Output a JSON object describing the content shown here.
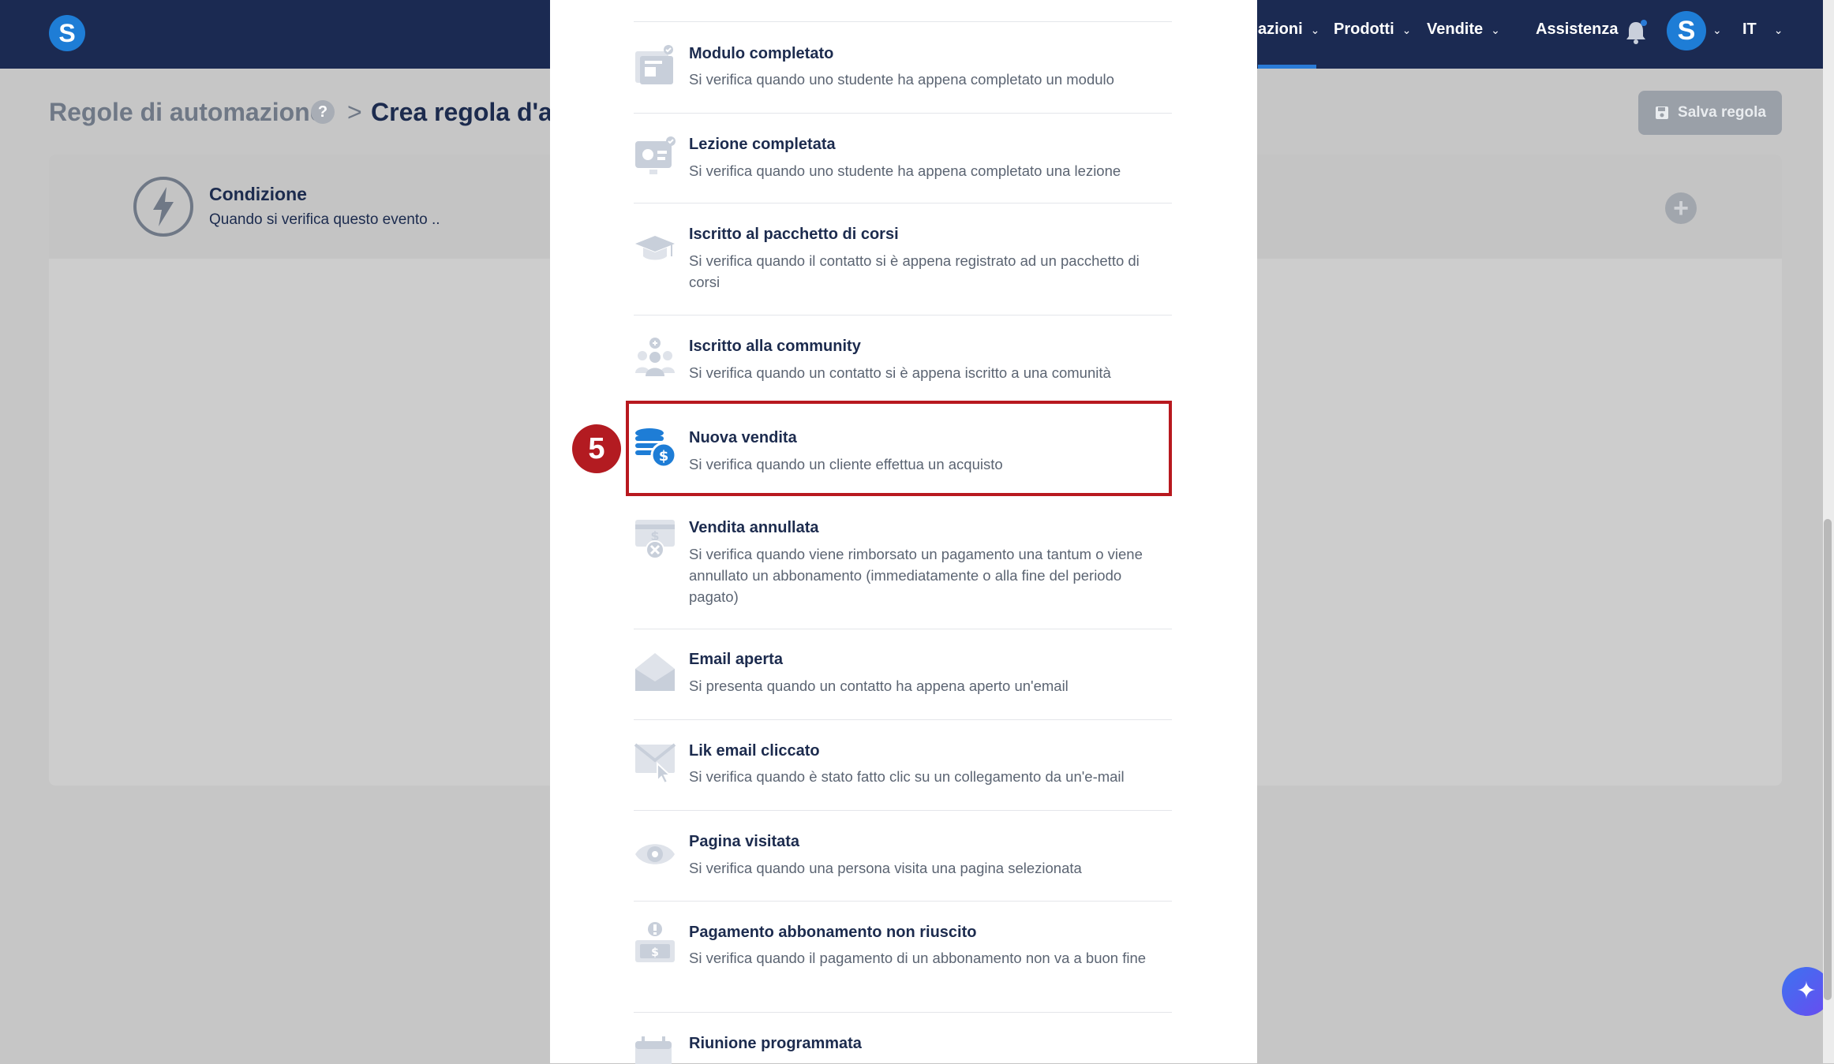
{
  "topbar": {
    "logo": "S",
    "nav": [
      {
        "label": "azioni"
      },
      {
        "label": "Prodotti"
      },
      {
        "label": "Vendite"
      },
      {
        "label": "Assistenza"
      }
    ],
    "avatar": "S",
    "language": "IT"
  },
  "page": {
    "breadcrumb_parent": "Regole di automazione",
    "help": "?",
    "breadcrumb_sep": ">",
    "breadcrumb_current": "Crea regola d'au",
    "save_label": "Salva regola"
  },
  "condition": {
    "title": "Condizione",
    "subtitle": "Quando si verifica questo evento .."
  },
  "triggers": [
    {
      "title": "Modulo completato",
      "description": "Si verifica quando uno studente ha appena completato un modulo",
      "icon": "module-complete-icon"
    },
    {
      "title": "Lezione completata",
      "description": "Si verifica quando uno studente ha appena completato una lezione",
      "icon": "lesson-complete-icon"
    },
    {
      "title": "Iscritto al pacchetto di corsi",
      "description": "Si verifica quando il contatto si è appena registrato ad un pacchetto di corsi",
      "icon": "graduation-cap-icon"
    },
    {
      "title": "Iscritto alla community",
      "description": "Si verifica quando un contatto si è appena iscritto a una comunità",
      "icon": "community-icon"
    },
    {
      "title": "Nuova vendita",
      "description": "Si verifica quando un cliente effettua un acquisto",
      "icon": "coins-dollar-icon"
    },
    {
      "title": "Vendita annullata",
      "description": "Si verifica quando viene rimborsato un pagamento una tantum o viene annullato un abbonamento (immediatamente o alla fine del periodo pagato)",
      "icon": "cancelled-sale-icon"
    },
    {
      "title": "Email aperta",
      "description": "Si presenta quando un contatto ha appena aperto un'email",
      "icon": "open-envelope-icon"
    },
    {
      "title": "Lik email cliccato",
      "description": "Si verifica quando è stato fatto clic su un collegamento da un'e-mail",
      "icon": "email-click-icon"
    },
    {
      "title": "Pagina visitata",
      "description": "Si verifica quando una persona visita una pagina selezionata",
      "icon": "eye-icon"
    },
    {
      "title": "Pagamento abbonamento non riuscito",
      "description": "Si verifica quando il pagamento di un abbonamento non va a buon fine",
      "icon": "payment-failed-icon"
    },
    {
      "title": "Riunione programmata",
      "description": "",
      "icon": "calendar-icon"
    }
  ],
  "annotation": {
    "step": "5"
  },
  "colors": {
    "topbar": "#1b2a52",
    "accent": "#1e7dd6",
    "highlight": "#b8191f",
    "title": "#1c2b4e"
  }
}
